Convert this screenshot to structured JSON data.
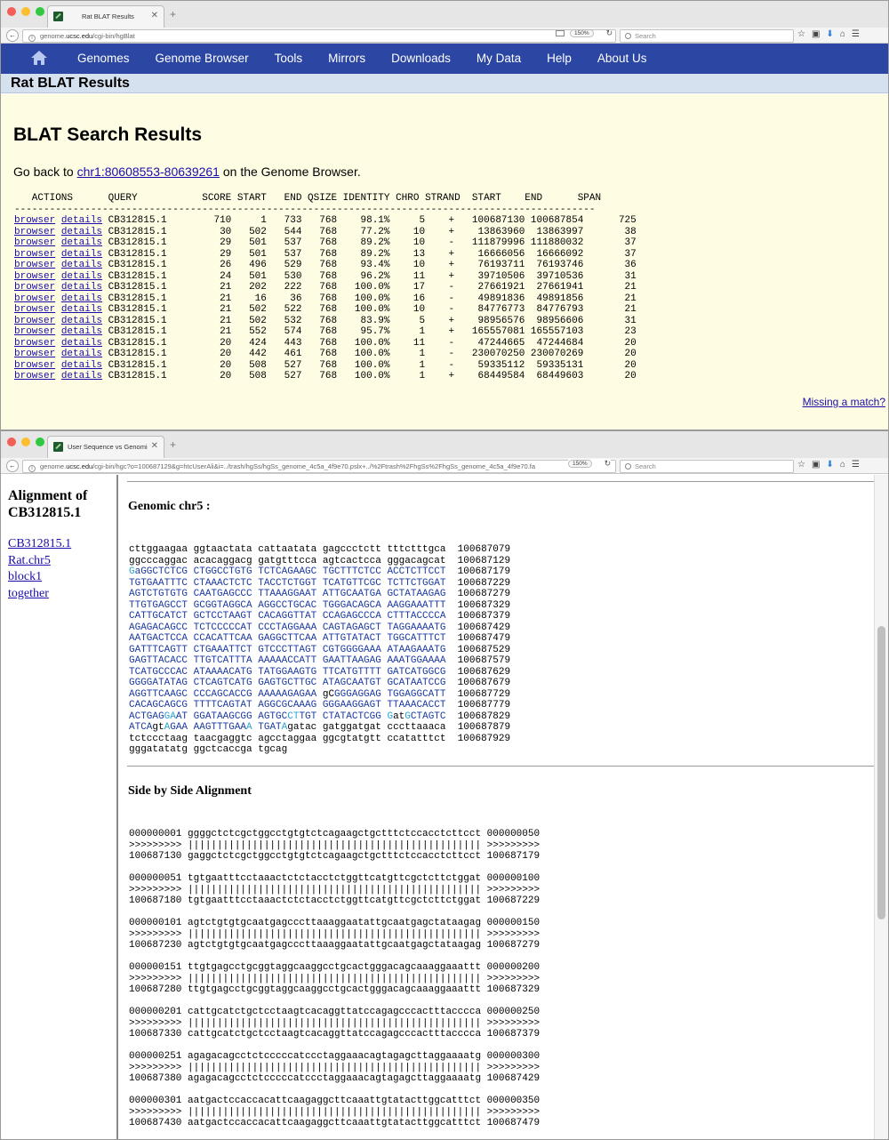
{
  "window1": {
    "tab_title": "Rat BLAT Results",
    "url_prefix": "genome.",
    "url_host": "ucsc.edu",
    "url_path": "/cgi-bin/hgBlat",
    "zoom": "150%",
    "search_placeholder": "Search",
    "nav_menu": [
      "Genomes",
      "Genome Browser",
      "Tools",
      "Mirrors",
      "Downloads",
      "My Data",
      "Help",
      "About Us"
    ],
    "page_header": "Rat BLAT Results",
    "results_title": "BLAT Search Results",
    "goback_prefix": "Go back to ",
    "goback_link": "chr1:80608553-80639261",
    "goback_suffix": " on the Genome Browser.",
    "table_header": "   ACTIONS      QUERY           SCORE START   END QSIZE IDENTITY CHRO STRAND  START    END      SPAN",
    "table_rule": "---------------------------------------------------------------------------------------------------",
    "row_action_browser": "browser",
    "row_action_details": "details",
    "rows": [
      {
        "query": "CB312815.1",
        "score": "710",
        "start": "1",
        "end": "733",
        "qsize": "768",
        "identity": "98.1%",
        "chro": "5",
        "strand": "+",
        "tstart": "100687130",
        "tend": "100687854",
        "span": "725"
      },
      {
        "query": "CB312815.1",
        "score": "30",
        "start": "502",
        "end": "544",
        "qsize": "768",
        "identity": "77.2%",
        "chro": "10",
        "strand": "+",
        "tstart": "13863960",
        "tend": "13863997",
        "span": "38"
      },
      {
        "query": "CB312815.1",
        "score": "29",
        "start": "501",
        "end": "537",
        "qsize": "768",
        "identity": "89.2%",
        "chro": "10",
        "strand": "-",
        "tstart": "111879996",
        "tend": "111880032",
        "span": "37"
      },
      {
        "query": "CB312815.1",
        "score": "29",
        "start": "501",
        "end": "537",
        "qsize": "768",
        "identity": "89.2%",
        "chro": "13",
        "strand": "+",
        "tstart": "16666056",
        "tend": "16666092",
        "span": "37"
      },
      {
        "query": "CB312815.1",
        "score": "26",
        "start": "496",
        "end": "529",
        "qsize": "768",
        "identity": "93.4%",
        "chro": "10",
        "strand": "+",
        "tstart": "76193711",
        "tend": "76193746",
        "span": "36"
      },
      {
        "query": "CB312815.1",
        "score": "24",
        "start": "501",
        "end": "530",
        "qsize": "768",
        "identity": "96.2%",
        "chro": "11",
        "strand": "+",
        "tstart": "39710506",
        "tend": "39710536",
        "span": "31"
      },
      {
        "query": "CB312815.1",
        "score": "21",
        "start": "202",
        "end": "222",
        "qsize": "768",
        "identity": "100.0%",
        "chro": "17",
        "strand": "-",
        "tstart": "27661921",
        "tend": "27661941",
        "span": "21"
      },
      {
        "query": "CB312815.1",
        "score": "21",
        "start": "16",
        "end": "36",
        "qsize": "768",
        "identity": "100.0%",
        "chro": "16",
        "strand": "-",
        "tstart": "49891836",
        "tend": "49891856",
        "span": "21"
      },
      {
        "query": "CB312815.1",
        "score": "21",
        "start": "502",
        "end": "522",
        "qsize": "768",
        "identity": "100.0%",
        "chro": "10",
        "strand": "-",
        "tstart": "84776773",
        "tend": "84776793",
        "span": "21"
      },
      {
        "query": "CB312815.1",
        "score": "21",
        "start": "502",
        "end": "532",
        "qsize": "768",
        "identity": "83.9%",
        "chro": "5",
        "strand": "+",
        "tstart": "98956576",
        "tend": "98956606",
        "span": "31"
      },
      {
        "query": "CB312815.1",
        "score": "21",
        "start": "552",
        "end": "574",
        "qsize": "768",
        "identity": "95.7%",
        "chro": "1",
        "strand": "+",
        "tstart": "165557081",
        "tend": "165557103",
        "span": "23"
      },
      {
        "query": "CB312815.1",
        "score": "20",
        "start": "424",
        "end": "443",
        "qsize": "768",
        "identity": "100.0%",
        "chro": "11",
        "strand": "-",
        "tstart": "47244665",
        "tend": "47244684",
        "span": "20"
      },
      {
        "query": "CB312815.1",
        "score": "20",
        "start": "442",
        "end": "461",
        "qsize": "768",
        "identity": "100.0%",
        "chro": "1",
        "strand": "-",
        "tstart": "230070250",
        "tend": "230070269",
        "span": "20"
      },
      {
        "query": "CB312815.1",
        "score": "20",
        "start": "508",
        "end": "527",
        "qsize": "768",
        "identity": "100.0%",
        "chro": "1",
        "strand": "-",
        "tstart": "59335112",
        "tend": "59335131",
        "span": "20"
      },
      {
        "query": "CB312815.1",
        "score": "20",
        "start": "508",
        "end": "527",
        "qsize": "768",
        "identity": "100.0%",
        "chro": "1",
        "strand": "+",
        "tstart": "68449584",
        "tend": "68449603",
        "span": "20"
      }
    ],
    "missing_match": "Missing a match?"
  },
  "window2": {
    "tab_title": "User Sequence vs Genomic",
    "url_prefix": "genome.",
    "url_host": "ucsc.edu",
    "url_path": "/cgi-bin/hgc?o=100687129&g=htcUserAli&i=../trash/hgSs/hgSs_genome_4c5a_4f9e70.pslx+../%2Ftrash%2FhgSs%2FhgSs_genome_4c5a_4f9e70.fa",
    "zoom": "150%",
    "search_placeholder": "Search",
    "left_title": "Alignment of CB312815.1",
    "left_links": [
      "CB312815.1",
      "Rat.chr5",
      "block1",
      "together"
    ],
    "genomic_title": "Genomic chr5 :",
    "genomic_lines": [
      [
        [
          "cttggaagaa ggtaactata cattaatata gagccctctt tttctttgca",
          "k"
        ],
        [
          "  100687079",
          "k"
        ]
      ],
      [
        [
          "ggcccaggac acacaggacg gatgtttcca agtcactcca gggacagcat",
          "k"
        ],
        [
          "  100687129",
          "k"
        ]
      ],
      [
        [
          "G",
          "c"
        ],
        [
          "aGGCTCTCG CTGGCCTGTG TCTCAGAAGC TGCTTTCTCC ACCTCTTCCT",
          "b"
        ],
        [
          "  100687179",
          "k"
        ]
      ],
      [
        [
          "TGTGAATTTC CTAAACTCTC TACCTCTGGT TCATGTTCGC TCTTCTGGAT",
          "b"
        ],
        [
          "  100687229",
          "k"
        ]
      ],
      [
        [
          "AGTCTGTGTG CAATGAGCCC TTAAAGGAAT ATTGCAATGA GCTATAAGAG",
          "b"
        ],
        [
          "  100687279",
          "k"
        ]
      ],
      [
        [
          "TTGTGAGCCT GCGGTAGGCA AGGCCTGCAC TGGGACAGCA AAGGAAATTT",
          "b"
        ],
        [
          "  100687329",
          "k"
        ]
      ],
      [
        [
          "CATTGCATCT GCTCCTAAGT CACAGGTTAT CCAGAGCCCA CTTTACCCCA",
          "b"
        ],
        [
          "  100687379",
          "k"
        ]
      ],
      [
        [
          "AGAGACAGCC TCTCCCCCAT CCCTAGGAAA CAGTAGAGCT TAGGAAAATG",
          "b"
        ],
        [
          "  100687429",
          "k"
        ]
      ],
      [
        [
          "AATGACTCCA CCACATTCAA GAGGCTTCAA ATTGTATACT TGGCATTTCT",
          "b"
        ],
        [
          "  100687479",
          "k"
        ]
      ],
      [
        [
          "GATTTCAGTT CTGAAATTCT GTCCCTTAGT CGTGGGGAAA ATAAGAAATG",
          "b"
        ],
        [
          "  100687529",
          "k"
        ]
      ],
      [
        [
          "GAGTTACACC TTGTCATTTA AAAAACCATT GAATTAAGAG AAATGGAAAA",
          "b"
        ],
        [
          "  100687579",
          "k"
        ]
      ],
      [
        [
          "TCATGCCCAC ATAAAACATG TATGGAAGTG TTCATGTTTT GATCATGGCG",
          "b"
        ],
        [
          "  100687629",
          "k"
        ]
      ],
      [
        [
          "GGGGATATAG CTCAGTCATG GAGTGCTTGC ATAGCAATGT GCATAATCCG",
          "b"
        ],
        [
          "  100687679",
          "k"
        ]
      ],
      [
        [
          "AGGTTCAAGC CCCAGCACCG AAAAAGAGAA ",
          "b"
        ],
        [
          "gC",
          "k"
        ],
        [
          "GGGAGGAG TGGAGGCATT",
          "b"
        ],
        [
          "  100687729",
          "k"
        ]
      ],
      [
        [
          "CACAGCAGCG TTTTCAGTAT AGGCGCAAAG GGGAAGGAGT TTAAACACCT",
          "b"
        ],
        [
          "  100687779",
          "k"
        ]
      ],
      [
        [
          "ACTGAG",
          "b"
        ],
        [
          "GA",
          "c"
        ],
        [
          "AT GGATAAGCGG AGTGC",
          "b"
        ],
        [
          "CT",
          "c"
        ],
        [
          "TGT CTATACTCGG ",
          "b"
        ],
        [
          "G",
          "c"
        ],
        [
          "at",
          "k"
        ],
        [
          "G",
          "c"
        ],
        [
          "CTAGTC",
          "b"
        ],
        [
          "  100687829",
          "k"
        ]
      ],
      [
        [
          "ATCA",
          "b"
        ],
        [
          "gt",
          "k"
        ],
        [
          "A",
          "c"
        ],
        [
          "GAA AAGTTTGAA",
          "b"
        ],
        [
          "A",
          "c"
        ],
        [
          " TGAT",
          "b"
        ],
        [
          "A",
          "c"
        ],
        [
          "gatac gatggatgat cccttaaaca",
          "k"
        ],
        [
          "  100687879",
          "k"
        ]
      ],
      [
        [
          "tctccctaag taacgaggtc agcctaggaa ggcgtatgtt ccatatttct",
          "k"
        ],
        [
          "  100687929",
          "k"
        ]
      ],
      [
        [
          "gggatatatg ggctcaccga tgcag",
          "k"
        ]
      ]
    ],
    "side_title": "Side by Side Alignment",
    "alignment_blocks": [
      [
        "000000001 ggggctctcgctggcctgtgtctcagaagctgctttctccacctcttcct 000000050",
        ">>>>>>>>> |||||||||||||||||||||||||||||||||||||||||||||||||| >>>>>>>>>",
        "100687130 gaggctctcgctggcctgtgtctcagaagctgctttctccacctcttcct 100687179"
      ],
      [
        "000000051 tgtgaatttcctaaactctctacctctggttcatgttcgctcttctggat 000000100",
        ">>>>>>>>> |||||||||||||||||||||||||||||||||||||||||||||||||| >>>>>>>>>",
        "100687180 tgtgaatttcctaaactctctacctctggttcatgttcgctcttctggat 100687229"
      ],
      [
        "000000101 agtctgtgtgcaatgagcccttaaaggaatattgcaatgagctataagag 000000150",
        ">>>>>>>>> |||||||||||||||||||||||||||||||||||||||||||||||||| >>>>>>>>>",
        "100687230 agtctgtgtgcaatgagcccttaaaggaatattgcaatgagctataagag 100687279"
      ],
      [
        "000000151 ttgtgagcctgcggtaggcaaggcctgcactgggacagcaaaggaaattt 000000200",
        ">>>>>>>>> |||||||||||||||||||||||||||||||||||||||||||||||||| >>>>>>>>>",
        "100687280 ttgtgagcctgcggtaggcaaggcctgcactgggacagcaaaggaaattt 100687329"
      ],
      [
        "000000201 cattgcatctgctcctaagtcacaggttatccagagcccactttacccca 000000250",
        ">>>>>>>>> |||||||||||||||||||||||||||||||||||||||||||||||||| >>>>>>>>>",
        "100687330 cattgcatctgctcctaagtcacaggttatccagagcccactttacccca 100687379"
      ],
      [
        "000000251 agagacagcctctcccccatccctaggaaacagtagagcttaggaaaatg 000000300",
        ">>>>>>>>> |||||||||||||||||||||||||||||||||||||||||||||||||| >>>>>>>>>",
        "100687380 agagacagcctctcccccatccctaggaaacagtagagcttaggaaaatg 100687429"
      ],
      [
        "000000301 aatgactccaccacattcaagaggcttcaaattgtatacttggcatttct 000000350",
        ">>>>>>>>> |||||||||||||||||||||||||||||||||||||||||||||||||| >>>>>>>>>",
        "100687430 aatgactccaccacattcaagaggcttcaaattgtatacttggcatttct 100687479"
      ]
    ]
  }
}
